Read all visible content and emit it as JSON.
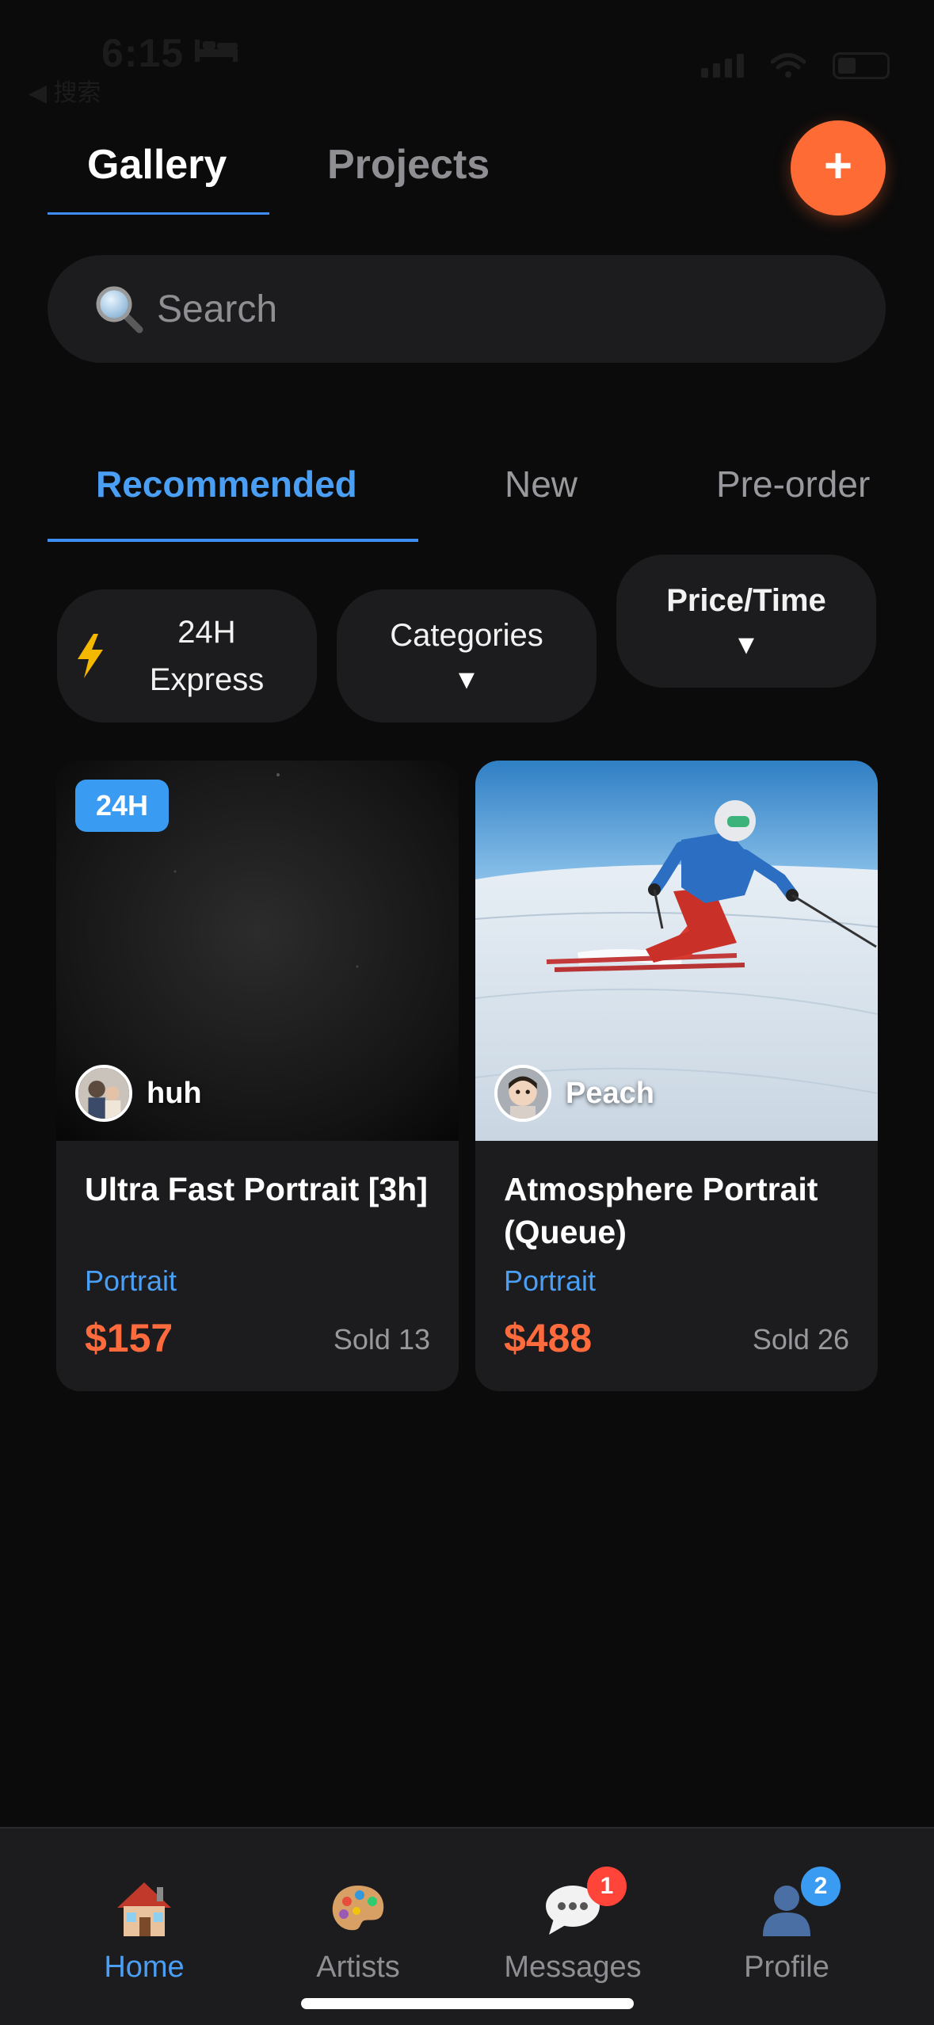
{
  "status_bar": {
    "time": "6:15",
    "back_label": "◀ 搜索"
  },
  "header": {
    "tabs": [
      {
        "label": "Gallery"
      },
      {
        "label": "Projects"
      }
    ],
    "add_label": "+"
  },
  "search": {
    "placeholder": "Search"
  },
  "sub_tabs": [
    {
      "label": "Recommended"
    },
    {
      "label": "New"
    },
    {
      "label": "Pre-order"
    }
  ],
  "filters": [
    {
      "label": "24H Express",
      "icon": "lightning-icon"
    },
    {
      "label": "Categories",
      "indicator": "▼"
    },
    {
      "label": "Price/Time",
      "indicator": "▼"
    }
  ],
  "cards": [
    {
      "badge": "24H",
      "artist": "huh",
      "title": "Ultra Fast Portrait [3h]",
      "category": "Portrait",
      "price": "$157",
      "sold": "Sold 13"
    },
    {
      "artist": "Peach",
      "title": "Atmosphere Portrait (Queue)",
      "category": "Portrait",
      "price": "$488",
      "sold": "Sold 26"
    }
  ],
  "bottom_nav": [
    {
      "label": "Home",
      "icon": "house-icon",
      "active": true
    },
    {
      "label": "Artists",
      "icon": "palette-icon"
    },
    {
      "label": "Messages",
      "icon": "speech-bubble-icon",
      "badge": "1"
    },
    {
      "label": "Profile",
      "icon": "person-icon",
      "badge": "2"
    }
  ],
  "colors": {
    "accent_blue": "#3d8ef0",
    "accent_orange": "#ff6b35",
    "price_orange": "#ff6b3d",
    "background": "#0b0b0b",
    "surface": "#1c1c1e"
  }
}
